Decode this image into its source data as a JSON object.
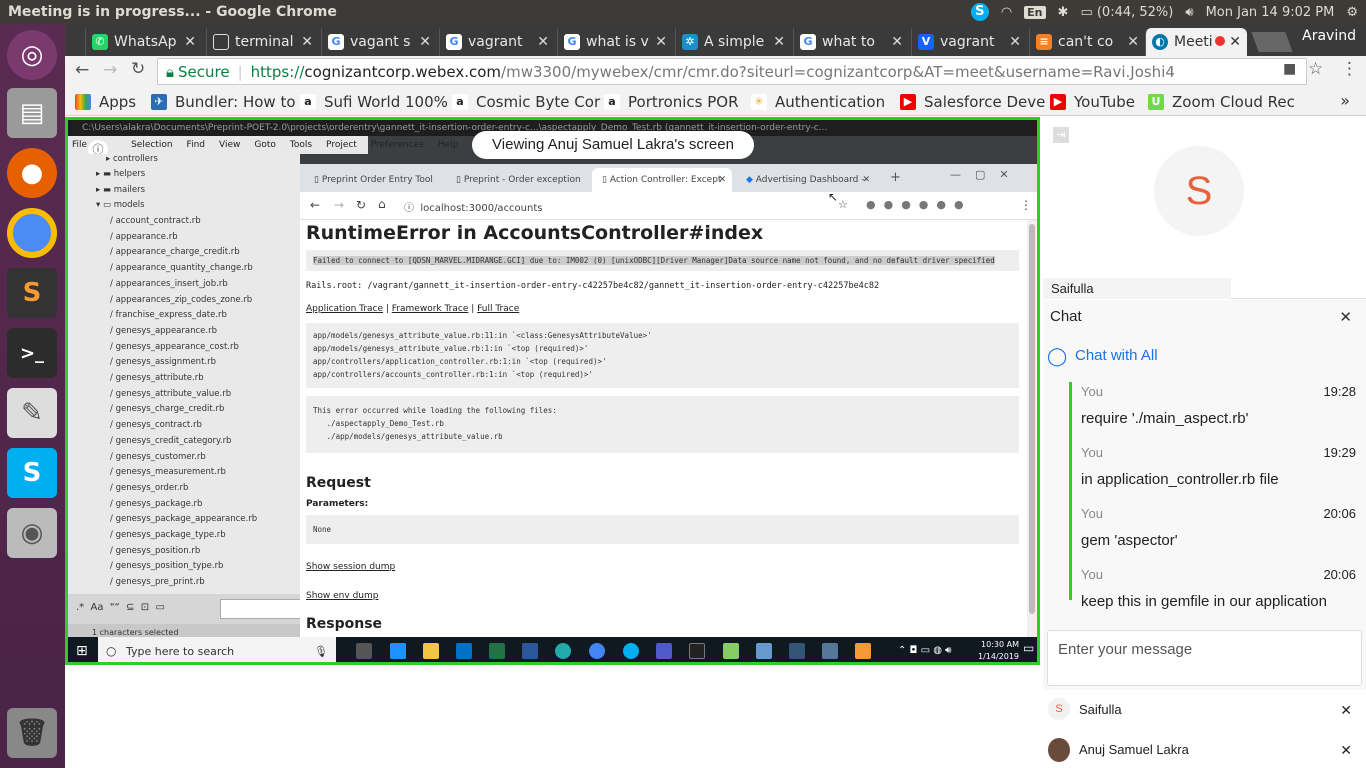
{
  "topbar": {
    "title": "Meeting is in progress... - Google Chrome",
    "lang": "En",
    "battery": "(0:44, 52%)",
    "clock": "Mon Jan 14  9:02 PM"
  },
  "tabs": [
    {
      "label": "WhatsAp",
      "color": "#25d366"
    },
    {
      "label": "terminal",
      "color": "#888"
    },
    {
      "label": "vagant s",
      "color": "#4285f4"
    },
    {
      "label": "vagrant",
      "color": "#4285f4"
    },
    {
      "label": "what is v",
      "color": "#4285f4"
    },
    {
      "label": "A simple",
      "color": "#1a8fc9"
    },
    {
      "label": "what to",
      "color": "#4285f4"
    },
    {
      "label": "vagrant",
      "color": "#1563ff"
    },
    {
      "label": "can't co",
      "color": "#f48024"
    },
    {
      "label": "Meeti",
      "color": "#07a"
    }
  ],
  "profile": "Aravind",
  "toolbar": {
    "secure": "Secure",
    "url_prefix": "https://",
    "url_host": "cognizantcorp.webex.com",
    "url_path": "/mw3300/mywebex/cmr/cmr.do?siteurl=cognizantcorp&AT=meet&username=Ravi.Joshi4"
  },
  "bookmarks": [
    {
      "label": "Apps",
      "icon": "apps-icon"
    },
    {
      "label": "Bundler: How to",
      "icon": "bundler-icon"
    },
    {
      "label": "Sufi World 100%",
      "icon": "amazon-icon"
    },
    {
      "label": "Cosmic Byte Cor",
      "icon": "amazon-icon"
    },
    {
      "label": "Portronics POR",
      "icon": "amazon-icon"
    },
    {
      "label": "Authentication",
      "icon": "auth-icon"
    },
    {
      "label": "Salesforce Deve",
      "icon": "youtube-icon"
    },
    {
      "label": "YouTube",
      "icon": "youtube-icon"
    },
    {
      "label": "Zoom Cloud Rec",
      "icon": "upwork-icon"
    }
  ],
  "share": {
    "banner": "Viewing Anuj Samuel Lakra's screen"
  },
  "editor": {
    "title": "C:\\Users\\alakra\\Documents\\Preprint-POET-2.0\\projects\\orderentry\\gannett_it-insertion-order-entry-c...\\aspectapply_Demo_Test.rb (gannett_it-insertion-order-entry-c...",
    "menu": [
      "File",
      "Edit",
      "Selection",
      "Find",
      "View",
      "Goto",
      "Tools",
      "Project",
      "Preferences",
      "Help"
    ],
    "folders": [
      "controllers",
      "helpers",
      "mailers",
      "models"
    ],
    "files": [
      "account_contract.rb",
      "appearance.rb",
      "appearance_charge_credit.rb",
      "appearance_quantity_change.rb",
      "appearances_insert_job.rb",
      "appearances_zip_codes_zone.rb",
      "franchise_express_date.rb",
      "genesys_appearance.rb",
      "genesys_appearance_cost.rb",
      "genesys_assignment.rb",
      "genesys_attribute.rb",
      "genesys_attribute_value.rb",
      "genesys_charge_credit.rb",
      "genesys_contract.rb",
      "genesys_credit_category.rb",
      "genesys_customer.rb",
      "genesys_measurement.rb",
      "genesys_order.rb",
      "genesys_package.rb",
      "genesys_package_appearance.rb",
      "genesys_package_type.rb",
      "genesys_position.rb",
      "genesys_position_type.rb",
      "genesys_pre_print.rb"
    ],
    "status": "1 characters selected"
  },
  "inner": {
    "tabs": [
      "Preprint Order Entry Tool",
      "Preprint - Order exception",
      "Action Controller: Except",
      "Advertising Dashboard -"
    ],
    "url": "localhost:3000/accounts",
    "heading": "RuntimeError in AccountsController#index",
    "error": "Failed to connect to [QDSN_MARVEL.MIDRANGE.GCI] due to: IM002 (0) [unixODBC][Driver Manager]Data source name not found, and no default driver specified",
    "rails_root": "Rails.root: /vagrant/gannett_it-insertion-order-entry-c42257be4c82/gannett_it-insertion-order-entry-c42257be4c82",
    "trace_links": [
      "Application Trace",
      "Framework Trace",
      "Full Trace"
    ],
    "trace": [
      "app/models/genesys_attribute_value.rb:11:in `<class:GenesysAttributeValue>'",
      "app/models/genesys_attribute_value.rb:1:in `<top (required)>'",
      "app/controllers/application_controller.rb:1:in `<top (required)>'",
      "app/controllers/accounts_controller.rb:1:in `<top (required)>'"
    ],
    "loading": [
      "This error occurred while loading the following files:",
      "   ./aspectapply_Demo_Test.rb",
      "   ./app/models/genesys_attribute_value.rb"
    ],
    "request": "Request",
    "params_label": "Parameters",
    "params_value": "None",
    "session_link": "Show session dump",
    "env_link": "Show env dump",
    "response": "Response"
  },
  "wintask": {
    "search": "Type here to search",
    "time": "10:30 AM",
    "date": "1/14/2019"
  },
  "video": {
    "initial": "S",
    "name": "Saifulla"
  },
  "chat": {
    "title": "Chat",
    "chat_with": "Chat with All",
    "messages": [
      {
        "from": "You",
        "time": "19:28",
        "text": "require './main_aspect.rb'"
      },
      {
        "from": "You",
        "time": "19:29",
        "text": "in application_controller.rb file"
      },
      {
        "from": "You",
        "time": "20:06",
        "text": "gem 'aspector'"
      },
      {
        "from": "You",
        "time": "20:06",
        "text": "keep this in gemfile in our application"
      }
    ],
    "placeholder": "Enter your message"
  },
  "participants": [
    {
      "initial": "S",
      "name": "Saifulla"
    },
    {
      "name": "Anuj Samuel Lakra"
    }
  ]
}
